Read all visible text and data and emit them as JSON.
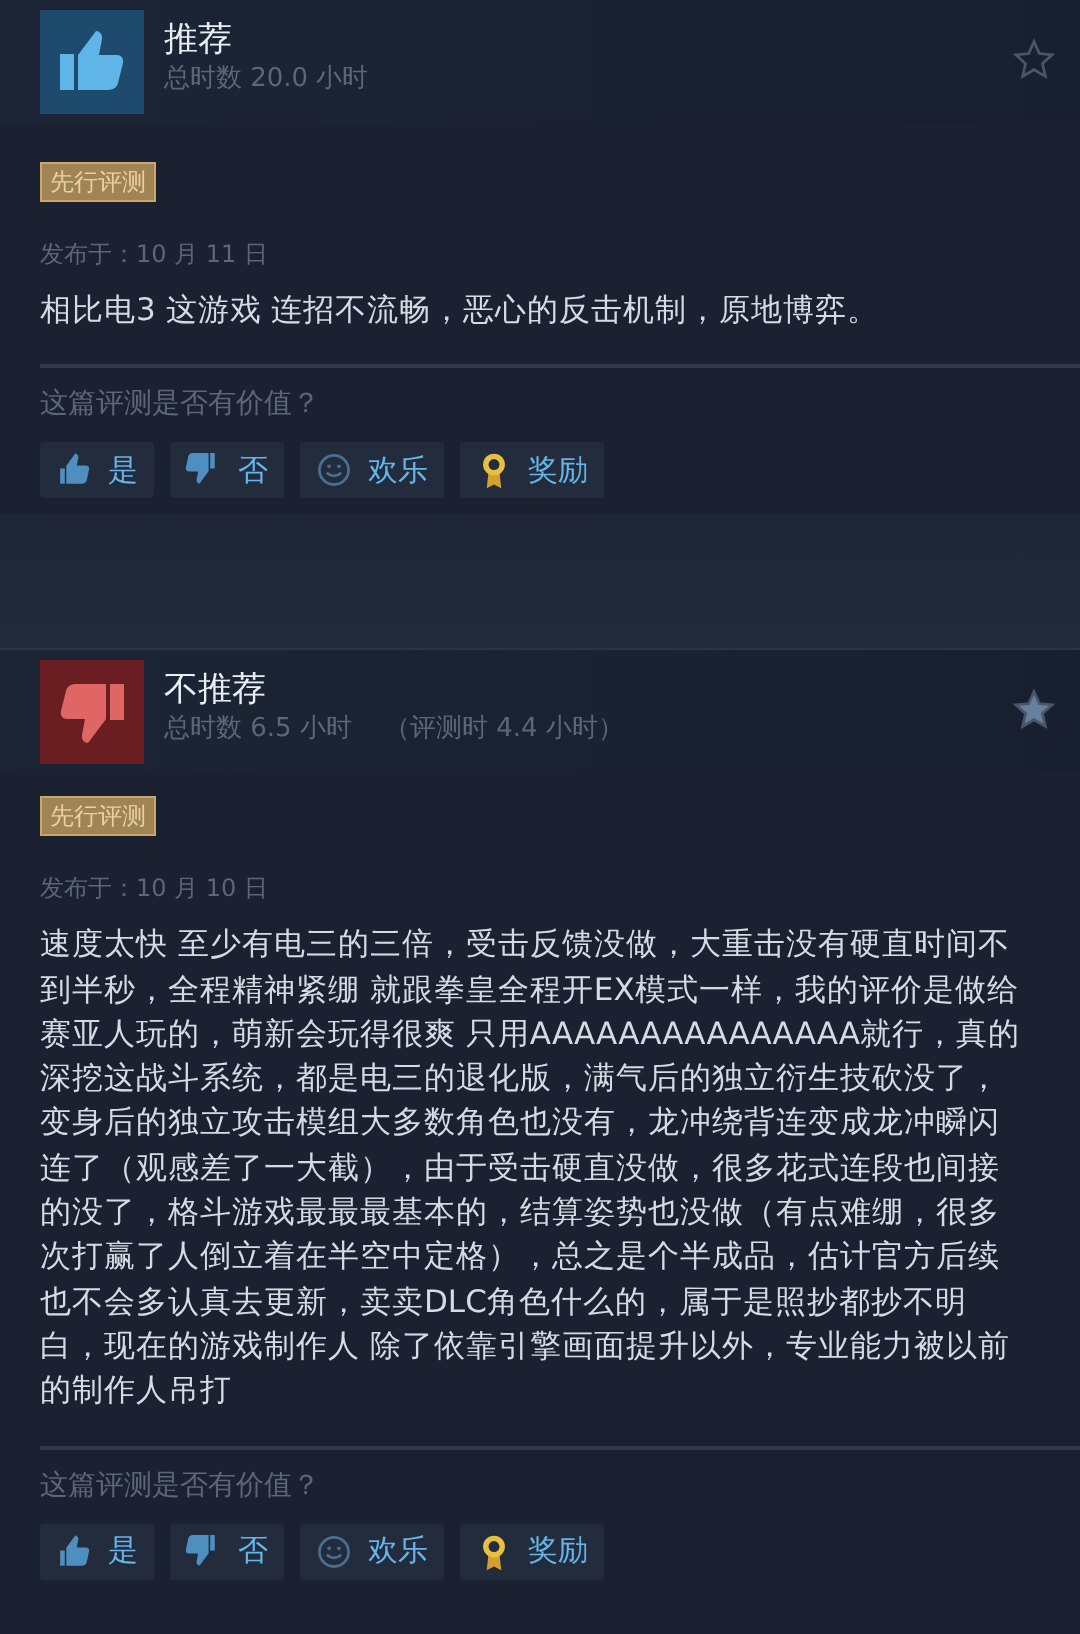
{
  "reviews": [
    {
      "recommended": true,
      "title": "推荐",
      "hours": "总时数 20.0 小时",
      "starred": false,
      "badge": "先行评测",
      "date": "发布于：10 月 11 日",
      "body": "相比电3 这游戏 连招不流畅，恶心的反击机制，原地博弈。",
      "question": "这篇评测是否有价值？",
      "buttons": [
        {
          "kind": "yes",
          "label": "是"
        },
        {
          "kind": "no",
          "label": "否"
        },
        {
          "kind": "funny",
          "label": "欢乐"
        },
        {
          "kind": "award",
          "label": "奖励"
        }
      ]
    },
    {
      "recommended": false,
      "title": "不推荐",
      "hours": "总时数 6.5 小时",
      "hours_at_review": "（评测时 4.4 小时）",
      "starred": true,
      "badge": "先行评测",
      "date": "发布于：10 月 10 日",
      "body": "速度太快 至少有电三的三倍，受击反馈没做，大重击没有硬直时间不到半秒，全程精神紧绷 就跟拳皇全程开EX模式一样，我的评价是做给赛亚人玩的，萌新会玩得很爽 只用AAAAAAAAAAAAAAA就行，真的深挖这战斗系统，都是电三的退化版，满气后的独立衍生技砍没了，变身后的独立攻击模组大多数角色也没有，龙冲绕背连变成龙冲瞬闪连了（观感差了一大截），由于受击硬直没做，很多花式连段也间接的没了，格斗游戏最最最基本的，结算姿势也没做（有点难绷，很多次打赢了人倒立着在半空中定格），总之是个半成品，估计官方后续也不会多认真去更新，卖卖DLC角色什么的，属于是照抄都抄不明白，现在的游戏制作人 除了依靠引擎画面提升以外，专业能力被以前的制作人吊打",
      "question": "这篇评测是否有价值？",
      "buttons": [
        {
          "kind": "yes",
          "label": "是"
        },
        {
          "kind": "no",
          "label": "否"
        },
        {
          "kind": "funny",
          "label": "欢乐"
        },
        {
          "kind": "award",
          "label": "奖励"
        }
      ]
    }
  ]
}
